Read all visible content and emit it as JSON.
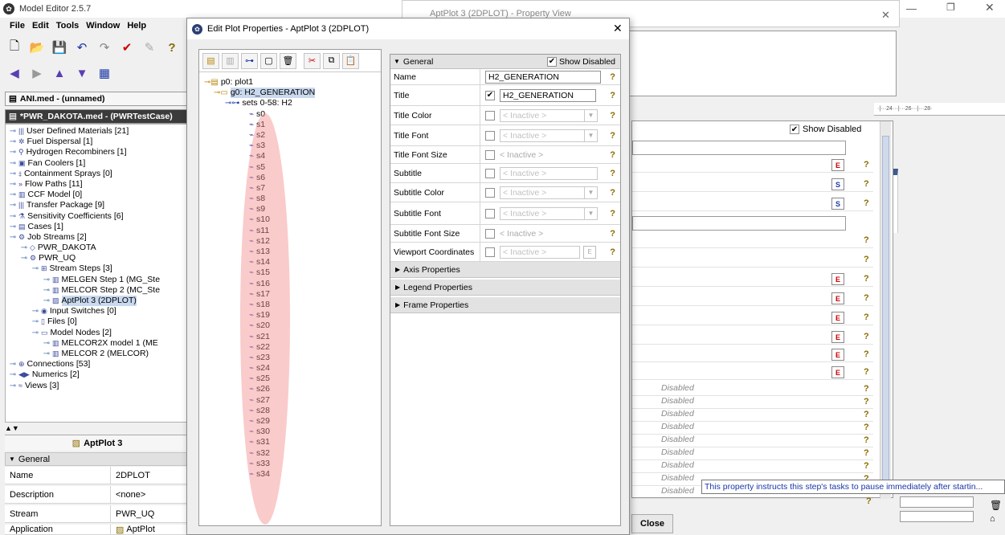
{
  "app": {
    "title": "Model Editor 2.5.7"
  },
  "menu": [
    "File",
    "Edit",
    "Tools",
    "Window",
    "Help"
  ],
  "left_tabs": {
    "tab1": "ANI.med - (unnamed)",
    "tab2": "*PWR_DAKOTA.med - (PWRTestCase)"
  },
  "left_tree": [
    {
      "label": "User Defined Materials [21]",
      "indent": 0,
      "icon": "|||"
    },
    {
      "label": "Fuel Dispersal [1]",
      "indent": 0,
      "icon": "✲"
    },
    {
      "label": "Hydrogen Recombiners [1]",
      "indent": 0,
      "icon": "⚲"
    },
    {
      "label": "Fan Coolers [1]",
      "indent": 0,
      "icon": "▣"
    },
    {
      "label": "Containment Sprays [0]",
      "indent": 0,
      "icon": "⤈"
    },
    {
      "label": "Flow Paths [11]",
      "indent": 0,
      "icon": "»"
    },
    {
      "label": "CCF Model [0]",
      "indent": 0,
      "icon": "▥"
    },
    {
      "label": "Transfer Package [9]",
      "indent": 0,
      "icon": "|||"
    },
    {
      "label": "Sensitivity Coefficients [6]",
      "indent": 0,
      "icon": "⚗"
    },
    {
      "label": "Cases [1]",
      "indent": 0,
      "icon": "▤"
    },
    {
      "label": "Job Streams [2]",
      "indent": 0,
      "icon": "⚙"
    },
    {
      "label": "PWR_DAKOTA",
      "indent": 1,
      "icon": "◇"
    },
    {
      "label": "PWR_UQ",
      "indent": 1,
      "icon": "⚙"
    },
    {
      "label": "Stream Steps [3]",
      "indent": 2,
      "icon": "⊞"
    },
    {
      "label": "MELGEN Step 1 (MG_Ste",
      "indent": 3,
      "icon": "▥"
    },
    {
      "label": "MELCOR Step 2 (MC_Ste",
      "indent": 3,
      "icon": "▥"
    },
    {
      "label": "AptPlot 3 (2DPLOT)",
      "indent": 3,
      "icon": "▨",
      "selected": true
    },
    {
      "label": "Input Switches [0]",
      "indent": 2,
      "icon": "◉"
    },
    {
      "label": "Files [0]",
      "indent": 2,
      "icon": "▯"
    },
    {
      "label": "Model Nodes [2]",
      "indent": 2,
      "icon": "▭"
    },
    {
      "label": "MELCOR2X model 1 (ME",
      "indent": 3,
      "icon": "▥"
    },
    {
      "label": "MELCOR 2 (MELCOR)",
      "indent": 3,
      "icon": "▥"
    },
    {
      "label": "Connections [53]",
      "indent": 0,
      "icon": "⊕"
    },
    {
      "label": "Numerics [2]",
      "indent": 0,
      "icon": "◀▶"
    },
    {
      "label": "Views [3]",
      "indent": 0,
      "icon": "≈"
    }
  ],
  "left_bottom": {
    "header": "AptPlot 3",
    "section": "General",
    "rows": [
      {
        "key": "Name",
        "value": "2DPLOT"
      },
      {
        "key": "Description",
        "value": "<none>"
      },
      {
        "key": "Stream",
        "value": "PWR_UQ"
      },
      {
        "key": "Application",
        "value": "AptPlot"
      }
    ]
  },
  "background_view": {
    "title": "AptPlot 3 (2DPLOT) - Property View",
    "show_disabled": "Show Disabled",
    "ruler": "·|···24···|···26···|···28·",
    "disabled_rows": [
      "Disabled",
      "Disabled",
      "Disabled",
      "Disabled",
      "Disabled",
      "Disabled",
      "Disabled",
      "Disabled",
      "Disabled"
    ],
    "tooltip": "This property instructs this step's tasks to pause immediately after startin...",
    "close_label": "Close"
  },
  "dialog": {
    "title": "Edit Plot Properties - AptPlot 3 (2DPLOT)",
    "tree": {
      "root": "p0: plot1",
      "group": "g0: H2_GENERATION",
      "sets": "sets 0-58: H2",
      "series": [
        "s0",
        "s1",
        "s2",
        "s3",
        "s4",
        "s5",
        "s6",
        "s7",
        "s8",
        "s9",
        "s10",
        "s11",
        "s12",
        "s13",
        "s14",
        "s15",
        "s16",
        "s17",
        "s18",
        "s19",
        "s20",
        "s21",
        "s22",
        "s23",
        "s24",
        "s25",
        "s26",
        "s27",
        "s28",
        "s29",
        "s30",
        "s31",
        "s32",
        "s33",
        "s34"
      ]
    },
    "props": {
      "section": "General",
      "show_disabled": "Show Disabled",
      "name_label": "Name",
      "name_value": "H2_GENERATION",
      "title_label": "Title",
      "title_value": "H2_GENERATION",
      "title_color": "Title Color",
      "title_font": "Title Font",
      "title_font_size": "Title Font Size",
      "subtitle": "Subtitle",
      "subtitle_color": "Subtitle Color",
      "subtitle_font": "Subtitle Font",
      "subtitle_font_size": "Subtitle Font Size",
      "viewport": "Viewport Coordinates",
      "inactive": "< Inactive >",
      "axis": "Axis Properties",
      "legend": "Legend Properties",
      "frame": "Frame Properties"
    }
  },
  "colors": {
    "accent": "#1a37a8",
    "highlight": "#f58c8c",
    "dark_tab": "#3b3b3b"
  }
}
